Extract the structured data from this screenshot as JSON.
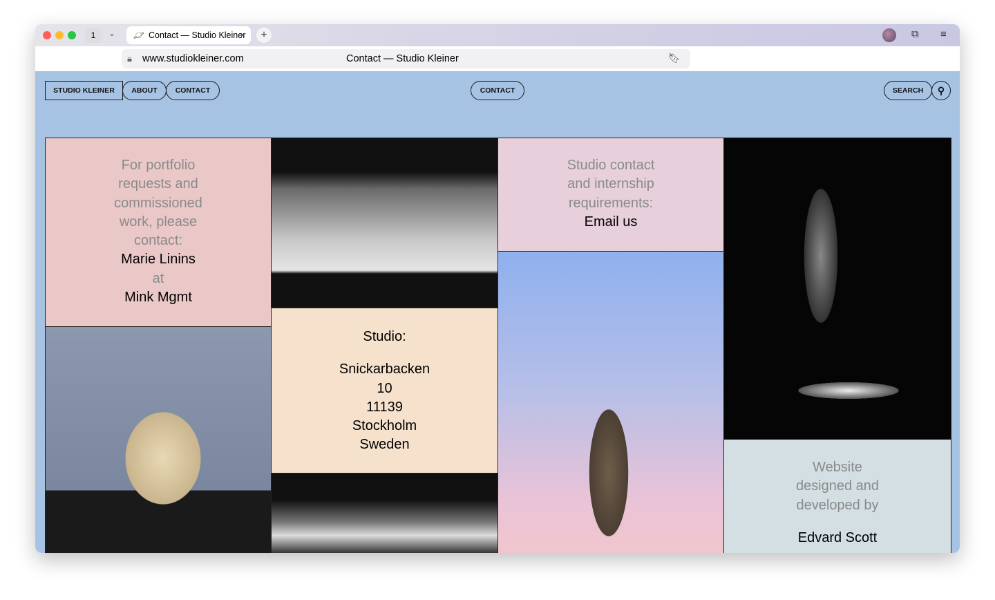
{
  "browser": {
    "tab_count": "1",
    "tab_title": "Contact — Studio Kleiner",
    "url": "www.studiokleiner.com",
    "page_title": "Contact — Studio Kleiner"
  },
  "nav": {
    "brand": "STUDIO KLEINER",
    "about": "ABOUT",
    "contact": "CONTACT",
    "center": "CONTACT",
    "search": "SEARCH"
  },
  "portfolio": {
    "lines": [
      "For portfolio",
      "requests and",
      "commissioned",
      "work, please",
      "contact:"
    ],
    "name": "Marie Linins",
    "at": "at",
    "agency": "Mink Mgmt"
  },
  "studio": {
    "label": "Studio:",
    "address": [
      "Snickarbacken",
      "10",
      "11139",
      "Stockholm",
      "Sweden"
    ]
  },
  "studio_contact": {
    "lines": [
      "Studio contact",
      "and internship",
      "requirements:"
    ],
    "link": "Email us"
  },
  "credits": {
    "lines": [
      "Website",
      "designed and",
      "developed by"
    ],
    "name": "Edvard Scott"
  },
  "colors": {
    "page_bg": "#a6c3e4",
    "pink": "#ebc8c8",
    "peach": "#f6e2cc",
    "lilac": "#e7d0dc",
    "slate": "#d4dfe3"
  }
}
